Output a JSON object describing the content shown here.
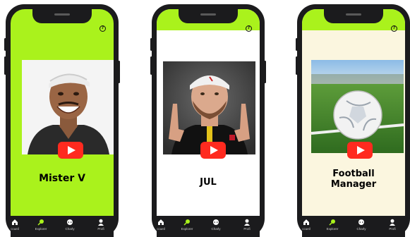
{
  "screens": [
    {
      "title": "Mister V",
      "background": "#aaf21c",
      "photo_subject": "smiling man in white cap",
      "icons": [
        "help-icon",
        "play-icon"
      ]
    },
    {
      "title": "JUL",
      "background": "#ffffff",
      "photo_subject": "man in white cap making hand signs",
      "icons": [
        "help-icon",
        "play-icon"
      ]
    },
    {
      "title_line1": "Football",
      "title_line2": "Manager",
      "background": "#fbf6df",
      "photo_subject": "football on grass",
      "icons": [
        "help-icon",
        "play-icon"
      ]
    }
  ],
  "nav": {
    "items": [
      {
        "label": "ccueil",
        "icon": "home-icon"
      },
      {
        "label": "Explorer",
        "icon": "explore-icon"
      },
      {
        "label": "Charly",
        "icon": "chat-icon"
      },
      {
        "label": "Profi",
        "icon": "profile-icon"
      }
    ]
  },
  "colors": {
    "accent_green": "#aaf21c",
    "play_red": "#ff2a1f",
    "phone_frame": "#1b1b1d"
  }
}
